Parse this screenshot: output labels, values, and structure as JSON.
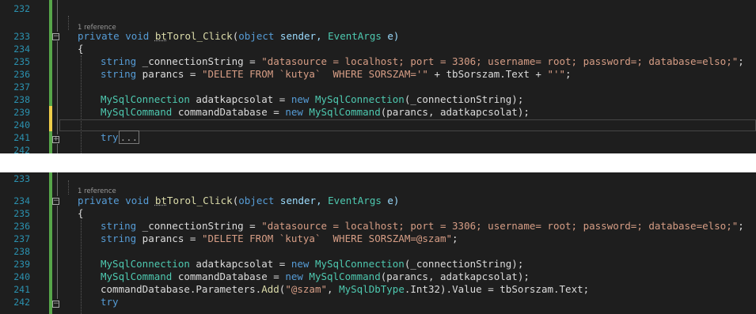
{
  "panel_top": {
    "line_numbers": [
      "232",
      "233",
      "234",
      "235",
      "236",
      "237",
      "238",
      "239",
      "240",
      "241",
      "242"
    ],
    "reference_label": "1 reference",
    "signature": {
      "private": "private",
      "void": "void",
      "name_a": "bt",
      "name_b": "Torol_Click",
      "open": "(",
      "object": "object",
      "sender": " sender, ",
      "eventargs": "EventArgs",
      "e": " e)"
    },
    "brace_open": "{",
    "conn": {
      "kw": "string",
      "name": " _connectionString = ",
      "value": "\"datasource = localhost; port = 3306; username= root; password=; database=elso;\"",
      "end": ";"
    },
    "parancs": {
      "kw": "string",
      "name": " parancs = ",
      "value1": "\"DELETE FROM `kutya`  WHERE SORSZAM='\"",
      "mid": " + tbSorszam.Text + ",
      "value2": "\"'\"",
      "end": ";"
    },
    "mysqlconn": {
      "type": "MySqlConnection",
      "name": " adatkapcsolat = ",
      "kw_new": "new",
      "sp": " ",
      "type2": "MySqlConnection",
      "args": "(_connectionString);"
    },
    "mysqlcmd": {
      "type": "MySqlCommand",
      "name": " commandDatabase = ",
      "kw_new": "new",
      "sp": " ",
      "type2": "MySqlCommand",
      "args": "(parancs, adatkapcsolat);"
    },
    "try_kw": "try",
    "try_collapsed": "..."
  },
  "panel_bottom": {
    "line_numbers": [
      "233",
      "234",
      "235",
      "236",
      "237",
      "238",
      "239",
      "240",
      "241",
      "242"
    ],
    "reference_label": "1 reference",
    "signature": {
      "private": "private",
      "void": "void",
      "name_a": "bt",
      "name_b": "Torol_Click",
      "open": "(",
      "object": "object",
      "sender": " sender, ",
      "eventargs": "EventArgs",
      "e": " e)"
    },
    "brace_open": "{",
    "conn": {
      "kw": "string",
      "name": " _connectionString = ",
      "value": "\"datasource = localhost; port = 3306; username= root; password=; database=elso;\"",
      "end": ";"
    },
    "parancs": {
      "kw": "string",
      "name": " parancs = ",
      "value": "\"DELETE FROM `kutya`  WHERE SORSZAM=@szam\"",
      "end": ";"
    },
    "mysqlconn": {
      "type": "MySqlConnection",
      "name": " adatkapcsolat = ",
      "kw_new": "new",
      "sp": " ",
      "type2": "MySqlConnection",
      "args": "(_connectionString);"
    },
    "mysqlcmd": {
      "type": "MySqlCommand",
      "name": " commandDatabase = ",
      "kw_new": "new",
      "sp": " ",
      "type2": "MySqlCommand",
      "args": "(parancs, adatkapcsolat);"
    },
    "params": {
      "obj": "commandDatabase.Parameters.",
      "method": "Add",
      "open": "(",
      "str": "\"@szam\"",
      "mid": ", ",
      "type": "MySqlDbType",
      "rest": ".Int32).Value = tbSorszam.Text;"
    },
    "try_kw": "try"
  },
  "colors": {
    "editor_bg": "#1e1e1e",
    "keyword": "#569cd6",
    "string": "#d69d85",
    "type": "#4ec9b0",
    "method": "#dcdcaa",
    "line_number": "#2b91af",
    "changed_saved": "#57a64a",
    "changed_unsaved": "#efce4a"
  }
}
